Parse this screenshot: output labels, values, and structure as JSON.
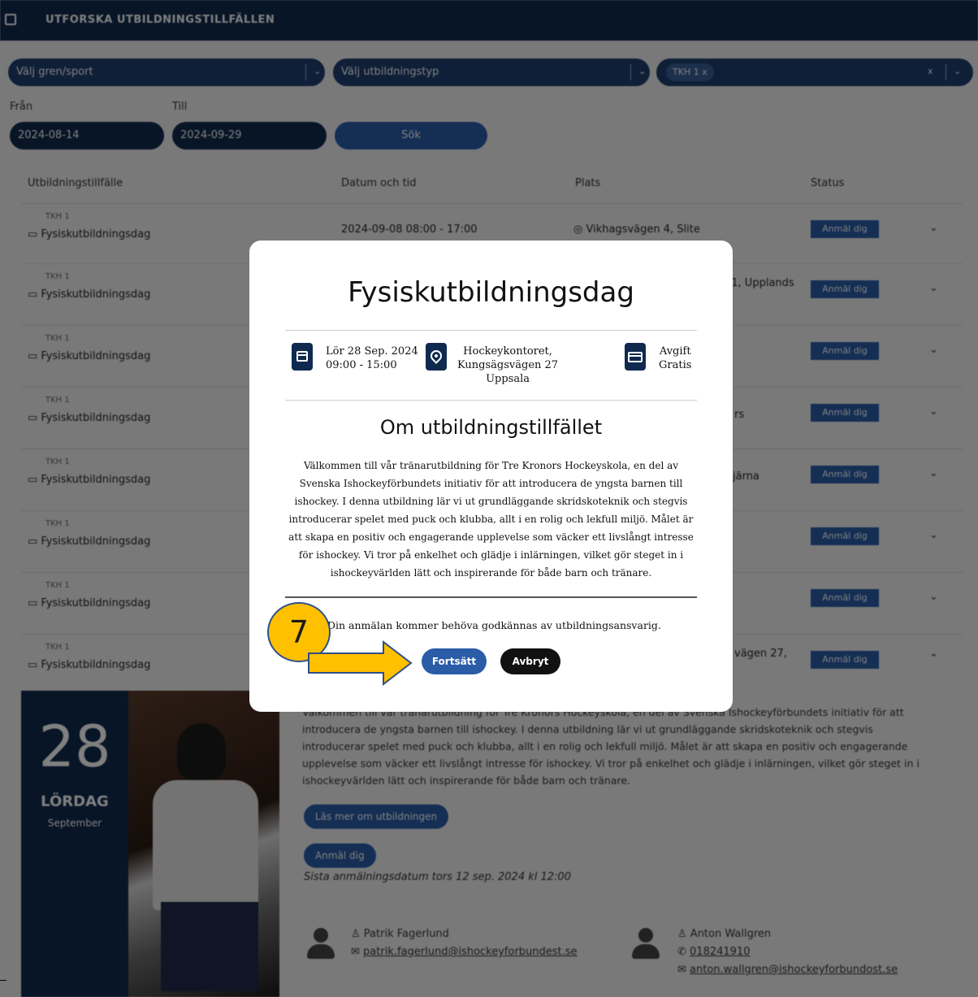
{
  "header": {
    "title": "UTFORSKA UTBILDNINGSTILLFÄLLEN"
  },
  "filters": {
    "sport_placeholder": "Välj gren/sport",
    "type_placeholder": "Välj utbildningstyp",
    "selected_chip": "TKH 1  x",
    "clear": "x",
    "chevron": "⌄",
    "from_label": "Från",
    "to_label": "Till",
    "from_value": "2024-08-14",
    "to_value": "2024-09-29",
    "search_label": "Sök"
  },
  "table": {
    "headers": [
      "Utbildningstillfälle",
      "Datum och tid",
      "Plats",
      "Status"
    ],
    "rows": [
      {
        "tag": "TKH 1",
        "name": "Fysiskutbildningsdag",
        "date": "2024-09-08 08:00 - 17:00",
        "place": "Vikhagsvägen 4, Slite",
        "status": "Anmäl dig",
        "chevron": "⌄"
      },
      {
        "tag": "TKH 1",
        "name": "Fysiskutbildningsdag",
        "date": "",
        "place": "11, Upplands",
        "status": "Anmäl dig",
        "chevron": "⌄"
      },
      {
        "tag": "TKH 1",
        "name": "Fysiskutbildningsdag",
        "date": "",
        "place": "",
        "status": "Anmäl dig",
        "chevron": "⌄"
      },
      {
        "tag": "TKH 1",
        "name": "Fysiskutbildningsdag",
        "date": "",
        "place": "rs",
        "status": "Anmäl dig",
        "chevron": "⌄"
      },
      {
        "tag": "TKH 1",
        "name": "Fysiskutbildningsdag",
        "date": "",
        "place": "järna",
        "status": "Anmäl dig",
        "chevron": "⌄"
      },
      {
        "tag": "TKH 1",
        "name": "Fysiskutbildningsdag",
        "date": "",
        "place": "",
        "status": "Anmäl dig",
        "chevron": "⌄"
      },
      {
        "tag": "TKH 1",
        "name": "Fysiskutbildningsdag",
        "date": "",
        "place": "",
        "status": "Anmäl dig",
        "chevron": "⌄"
      },
      {
        "tag": "TKH 1",
        "name": "Fysiskutbildningsdag",
        "date": "",
        "place": "vägen 27,",
        "status": "Anmäl dig",
        "chevron": "⌃"
      }
    ]
  },
  "detail": {
    "day": "28",
    "weekday": "LÖRDAG",
    "month": "September",
    "description": "Välkommen till vår tränarutbildning för Tre Kronors Hockeyskola, en del av Svenska Ishockeyförbundets initiativ för att introducera de yngsta barnen till ishockey. I denna utbildning lär vi ut grundläggande skridskoteknik och stegvis introducerar spelet med puck och klubba, allt i en rolig och lekfull miljö. Målet är att skapa en positiv och engagerande upplevelse som väcker ett livslångt intresse för ishockey. Vi tror på enkelhet och glädje i inlärningen, vilket gör steget in i ishockeyvärlden lätt och inspirerande för både barn och tränare.",
    "read_more": "Läs mer om utbildningen",
    "register": "Anmäl dig",
    "last_date": "Sista anmälningsdatum tors 12 sep. 2024 kl 12:00",
    "contact1": {
      "name": "Patrik Fagerlund",
      "email": "patrik.fagerlund@ishockeyforbundest.se"
    },
    "contact2": {
      "name": "Anton Wallgren",
      "phone": "018241910",
      "email": "anton.wallgren@ishockeyforbundost.se"
    }
  },
  "modal": {
    "title": "Fysiskutbildningsdag",
    "date_line1": "Lör 28 Sep. 2024",
    "date_line2": "09:00 - 15:00",
    "place_line1": "Hockeykontoret,",
    "place_line2": "Kungsägsvägen 27",
    "place_line3": "Uppsala",
    "fee_label": "Avgift",
    "fee_value": "Gratis",
    "about_heading": "Om utbildningstillfället",
    "about_text": "Välkommen till vår tränarutbildning för Tre Kronors Hockeyskola, en del av Svenska Ishockeyförbundets initiativ för att introducera de yngsta barnen till ishockey. I denna utbildning lär vi ut grundläggande skridskoteknik och stegvis introducerar spelet med puck och klubba, allt i en rolig och lekfull miljö. Målet är att skapa en positiv och engagerande upplevelse som väcker ett livslångt intresse för ishockey. Vi tror på enkelhet och glädje i inlärningen, vilket gör steget in i ishockeyvärlden lätt och inspirerande för både barn och tränare.",
    "approval_note": "Din anmälan kommer behöva godkännas av utbildningsansvarig.",
    "continue_label": "Fortsätt",
    "cancel_label": "Avbryt"
  },
  "annotation": {
    "step": "7"
  },
  "colors": {
    "navy": "#0f2a4e",
    "blue": "#2a5ca8",
    "annotation": "#ffc000"
  }
}
